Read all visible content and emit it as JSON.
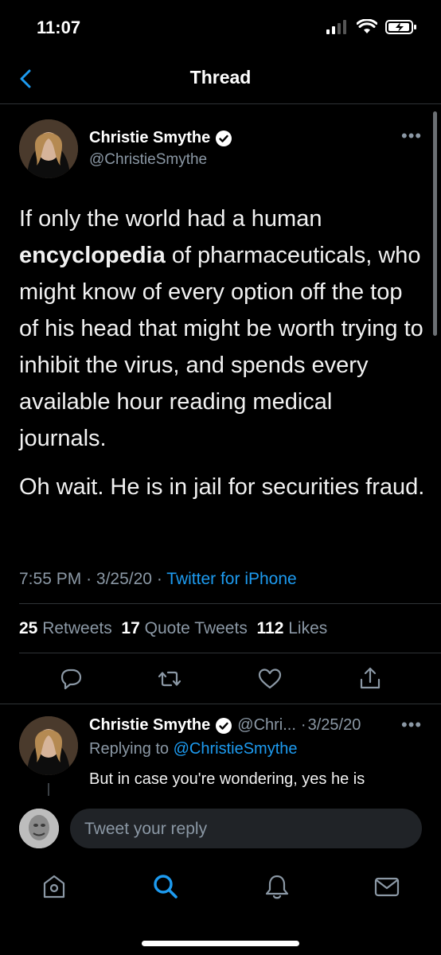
{
  "status_bar": {
    "time": "11:07"
  },
  "header": {
    "title": "Thread"
  },
  "tweet": {
    "author_name": "Christie Smythe",
    "author_handle": "@ChristieSmythe",
    "text_p1_pre": "If only the world had a human",
    "text_p1_bold": "encyclopedia",
    "text_p1_post": "of pharmaceuticals, who might know of every option off the top of his head that might be worth trying to inhibit the virus, and spends every available hour reading medical journals.",
    "text_p2": "Oh wait. He is in jail for securities fraud.",
    "time": "7:55 PM",
    "date": "3/25/20",
    "separator": "·",
    "source": "Twitter for iPhone",
    "retweets_count": "25",
    "retweets_label": "Retweets",
    "quotes_count": "17",
    "quotes_label": "Quote Tweets",
    "likes_count": "112",
    "likes_label": "Likes"
  },
  "reply": {
    "author_name": "Christie Smythe",
    "author_handle": "@Chri...",
    "date": "3/25/20",
    "replying_prefix": "Replying to",
    "replying_to": "@ChristieSmythe",
    "text": "But in case you're wondering, yes he is"
  },
  "composer": {
    "placeholder": "Tweet your reply"
  },
  "icons": {
    "back": "chevron-left-icon",
    "verified": "verified-badge-icon",
    "more": "more-icon",
    "reply": "reply-icon",
    "retweet": "retweet-icon",
    "like": "heart-icon",
    "share": "share-icon",
    "tabs": [
      "home-icon",
      "search-icon",
      "notifications-icon",
      "messages-icon"
    ]
  },
  "colors": {
    "accent": "#1d9bf0",
    "secondary_text": "#8b98a5",
    "background": "#000000"
  }
}
